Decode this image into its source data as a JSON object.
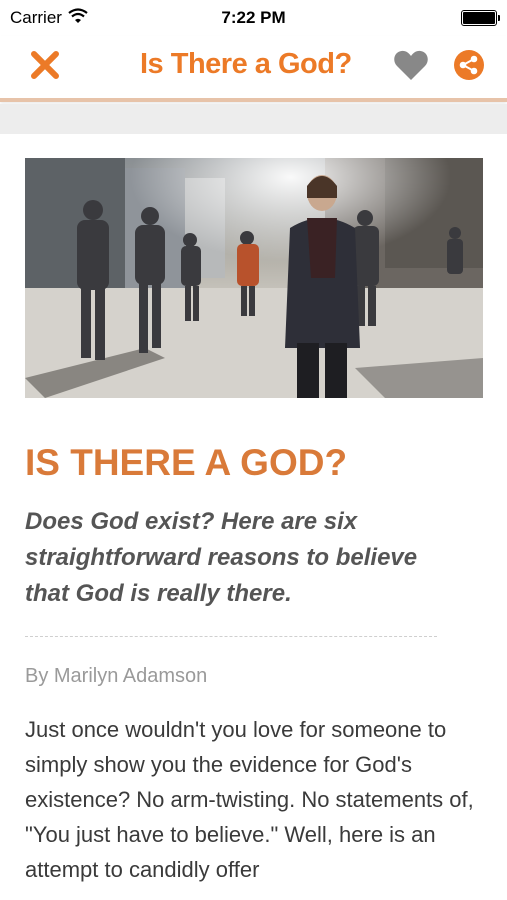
{
  "status_bar": {
    "carrier": "Carrier",
    "time": "7:22 PM"
  },
  "nav": {
    "title": "Is There a God?",
    "accent_color": "#ec7a27"
  },
  "article": {
    "title": "IS THERE A GOD?",
    "subtitle": "Does God exist? Here are six straightforward reasons to believe that God is really there.",
    "byline": "By Marilyn Adamson",
    "body": "Just once wouldn't you love for someone to simply show you the evidence for God's existence? No arm-twisting. No statements of, \"You just have to believe.\" Well, here is an attempt to candidly offer"
  }
}
